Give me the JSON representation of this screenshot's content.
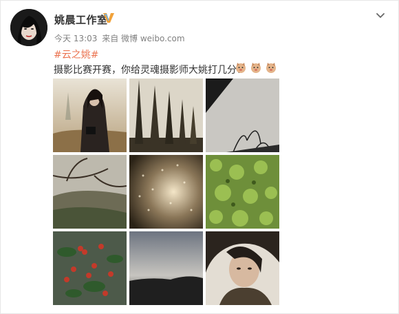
{
  "post": {
    "author": "姚晨工作室",
    "verified_icon": "verified-v-icon",
    "time_prefix": "今天 13:03",
    "source": "来自 微博 weibo.com",
    "topic": "#云之姚#",
    "text": "摄影比赛开赛，你给灵魂摄影师大姚打几分？",
    "emoji": [
      "doge-emoji",
      "doge-emoji",
      "doge-emoji"
    ]
  },
  "photos": [
    {
      "name": "photo-woman-with-camera"
    },
    {
      "name": "photo-tall-trees"
    },
    {
      "name": "photo-branches-sky"
    },
    {
      "name": "photo-bare-tree-valley"
    },
    {
      "name": "photo-light-bokeh"
    },
    {
      "name": "photo-green-moss"
    },
    {
      "name": "photo-red-berries"
    },
    {
      "name": "photo-dusk-landscape"
    },
    {
      "name": "photo-woman-portrait"
    }
  ],
  "colors": {
    "accent": "#eb7350",
    "verified": "#f1a23a",
    "text": "#333333",
    "meta": "#808080"
  }
}
